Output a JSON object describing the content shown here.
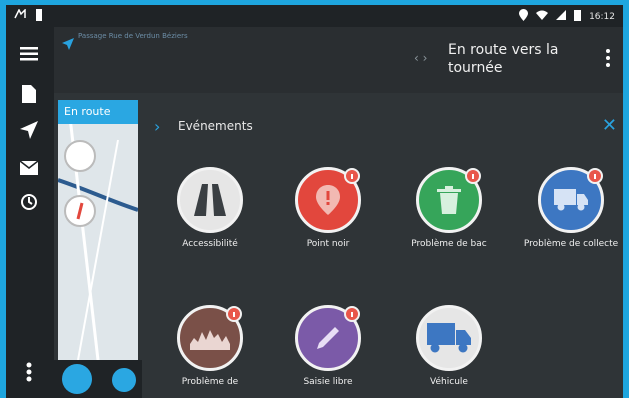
{
  "status_bar": {
    "time": "16:12"
  },
  "top_bar": {
    "subtitle": "Passage Rue de Verdun Béziers",
    "title": "En route vers la tournée"
  },
  "map": {
    "tab_label": "En route"
  },
  "events_panel": {
    "title": "Evénements",
    "items": [
      {
        "label": "Accessibilité",
        "icon": "road-icon",
        "color": "#e6e6e6"
      },
      {
        "label": "Point noir",
        "icon": "map-pin-alert-icon",
        "color": "#e2473d"
      },
      {
        "label": "Problème de bac",
        "icon": "trash-bin-icon",
        "color": "#36a55a"
      },
      {
        "label": "Problème de collecte",
        "icon": "truck-icon",
        "color": "#3d77c2"
      },
      {
        "label": "Problème de",
        "icon": "audio-wave-icon",
        "color": "#7a5048"
      },
      {
        "label": "Saisie libre",
        "icon": "pen-icon",
        "color": "#7b5aa8"
      },
      {
        "label": "Véhicule",
        "icon": "vehicle-truck-icon",
        "color": "#e6e6e6"
      }
    ]
  },
  "colors": {
    "accent": "#29a2df",
    "frame": "#1ea6df",
    "panel_bg": "#2f3437"
  }
}
